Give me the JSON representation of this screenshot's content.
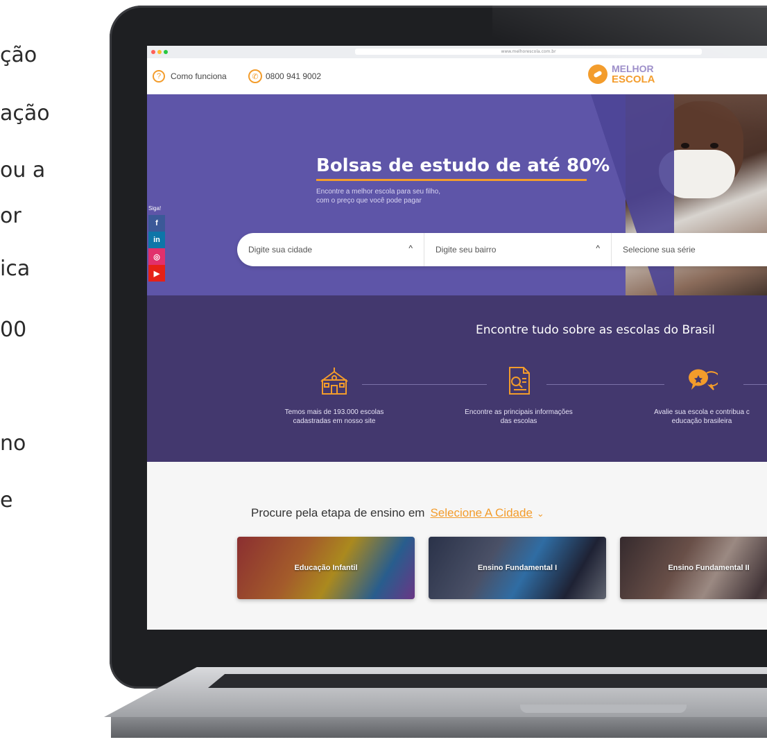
{
  "left_text": {
    "lines": [
      "ção",
      "ação",
      "ou a",
      "or",
      "ica",
      "00",
      "no",
      "e"
    ]
  },
  "browser": {
    "url": "www.melhorescola.com.br"
  },
  "header": {
    "how_it_works": "Como funciona",
    "phone": "0800 941 9002",
    "logo_line1": "MELHOR",
    "logo_line2": "ESCOLA"
  },
  "hero": {
    "title": "Bolsas de estudo de até 80%",
    "subtitle_line1": "Encontre a melhor escola para seu filho,",
    "subtitle_line2": "com o preço que você pode pagar",
    "social_label": "Siga!",
    "social": [
      {
        "icon": "facebook-icon",
        "glyph": "f",
        "color": "#3b5998"
      },
      {
        "icon": "linkedin-icon",
        "glyph": "in",
        "color": "#0e76a8"
      },
      {
        "icon": "instagram-icon",
        "glyph": "◎",
        "color": "#e1306c"
      },
      {
        "icon": "youtube-icon",
        "glyph": "▶",
        "color": "#e62117"
      }
    ],
    "search": {
      "city": "Digite sua cidade",
      "neighborhood": "Digite seu bairro",
      "grade": "Selecione sua série",
      "chevron": "^"
    }
  },
  "features": {
    "title": "Encontre tudo sobre as escolas do Brasil",
    "items": [
      {
        "icon": "school-building-icon",
        "line1": "Temos mais de 193.000 escolas",
        "line2": "cadastradas em nosso site"
      },
      {
        "icon": "document-search-icon",
        "line1": "Encontre as principais informações",
        "line2": "das escolas"
      },
      {
        "icon": "review-chat-icon",
        "line1": "Avalie sua escola e contribua c",
        "line2": "educação brasileira"
      }
    ]
  },
  "etapa": {
    "title": "Procure pela etapa de ensino em",
    "link": "Selecione A Cidade",
    "chevron": "⌄",
    "cards": [
      {
        "label": "Educação Infantil"
      },
      {
        "label": "Ensino Fundamental I"
      },
      {
        "label": "Ensino Fundamental II"
      }
    ]
  },
  "colors": {
    "accent": "#f39c2b",
    "hero_bg": "#5e55a8",
    "features_bg": "#43386e"
  }
}
